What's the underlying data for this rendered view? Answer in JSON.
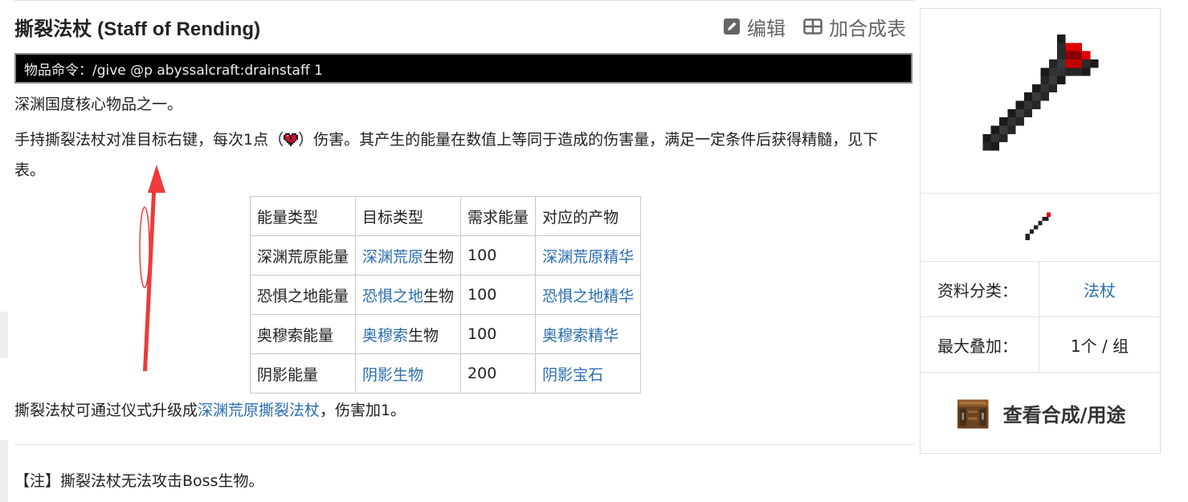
{
  "header": {
    "title": "撕裂法杖 (Staff of Rending)",
    "edit_label": "编辑",
    "add_recipe_label": "加合成表"
  },
  "command": {
    "text": "物品命令：/give @p abyssalcraft:drainstaff 1"
  },
  "content": {
    "intro": "深渊国度核心物品之一。",
    "usage_before": "手持撕裂法杖对准目标右键，每次1点（",
    "usage_after": "）伤害。其产生的能量在数值上等同于造成的伤害量，满足一定条件后获得精髓，见下表。",
    "upgrade_before": "撕裂法杖可通过仪式升级成",
    "upgrade_link": "深渊荒原撕裂法杖",
    "upgrade_after": "，伤害加1。",
    "note": "【注】撕裂法杖无法攻击Boss生物。"
  },
  "table": {
    "headers": [
      "能量类型",
      "目标类型",
      "需求能量",
      "对应的产物"
    ],
    "rows": [
      {
        "energy": "深渊荒原能量",
        "target_link": "深渊荒原",
        "target_suffix": "生物",
        "required": "100",
        "product": "深渊荒原精华"
      },
      {
        "energy": "恐惧之地能量",
        "target_link": "恐惧之地",
        "target_suffix": "生物",
        "required": "100",
        "product": "恐惧之地精华"
      },
      {
        "energy": "奥穆索能量",
        "target_link": "奥穆索",
        "target_suffix": "生物",
        "required": "100",
        "product": "奥穆索精华"
      },
      {
        "energy": "阴影能量",
        "target_link": "阴影生物",
        "target_suffix": "",
        "required": "200",
        "product": "阴影宝石"
      }
    ]
  },
  "infobox": {
    "category_label": "资料分类：",
    "category_value": "法杖",
    "stack_label": "最大叠加：",
    "stack_value": "1个 / 组",
    "craft_label": "查看合成/用途"
  },
  "icons": {
    "edit": "edit-icon",
    "recipe": "table-icon",
    "heart": "heart-icon",
    "staff": "staff-icon",
    "crafting_table": "crafting-table-icon",
    "annotation": "red-arrow-annotation"
  },
  "colors": {
    "link": "#2a6db0",
    "command_bg": "#000000",
    "annotation": "#ee3a3a"
  }
}
